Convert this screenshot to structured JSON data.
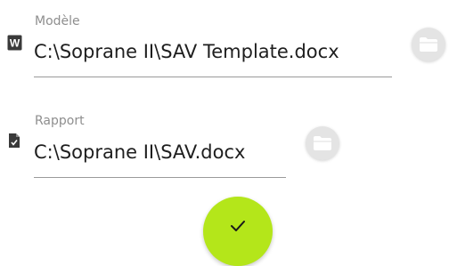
{
  "modele": {
    "caption": "Modèle",
    "value": "C:\\Soprane II\\SAV Template.docx",
    "icon": "word-file-icon",
    "icon_letter": "W",
    "browse_icon": "folder-open-icon"
  },
  "rapport": {
    "caption": "Rapport",
    "value": "C:\\Soprane II\\SAV.docx",
    "icon": "document-file-icon",
    "browse_icon": "folder-open-icon"
  },
  "confirm": {
    "icon": "check-icon",
    "color": "#b4e61a"
  }
}
